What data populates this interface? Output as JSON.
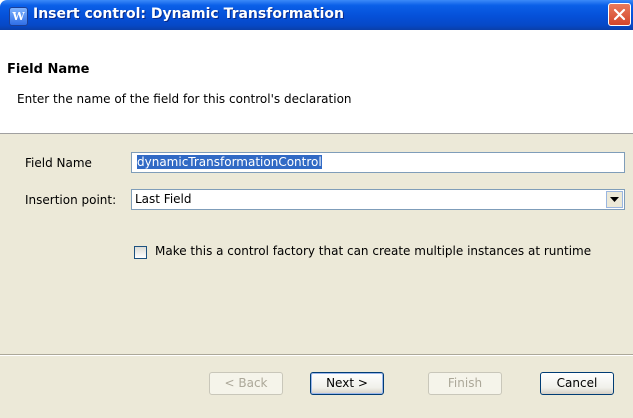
{
  "window": {
    "title": "Insert control: Dynamic Transformation",
    "icon": "app-w-icon"
  },
  "header": {
    "title": "Field Name",
    "description": "Enter the name of the field for this control's declaration"
  },
  "form": {
    "field_name_label": "Field Name",
    "field_name_value": "dynamicTransformationControl",
    "insertion_point_label": "Insertion point:",
    "insertion_point_value": "Last Field",
    "factory_checkbox_label": "Make this a control factory that can create multiple instances at runtime",
    "factory_checked": false
  },
  "buttons": {
    "back": "< Back",
    "next": "Next >",
    "finish": "Finish",
    "cancel": "Cancel"
  },
  "colors": {
    "titlebar": "#0550d8",
    "selection": "#316ac5",
    "dialog_bg": "#ece9d8"
  }
}
